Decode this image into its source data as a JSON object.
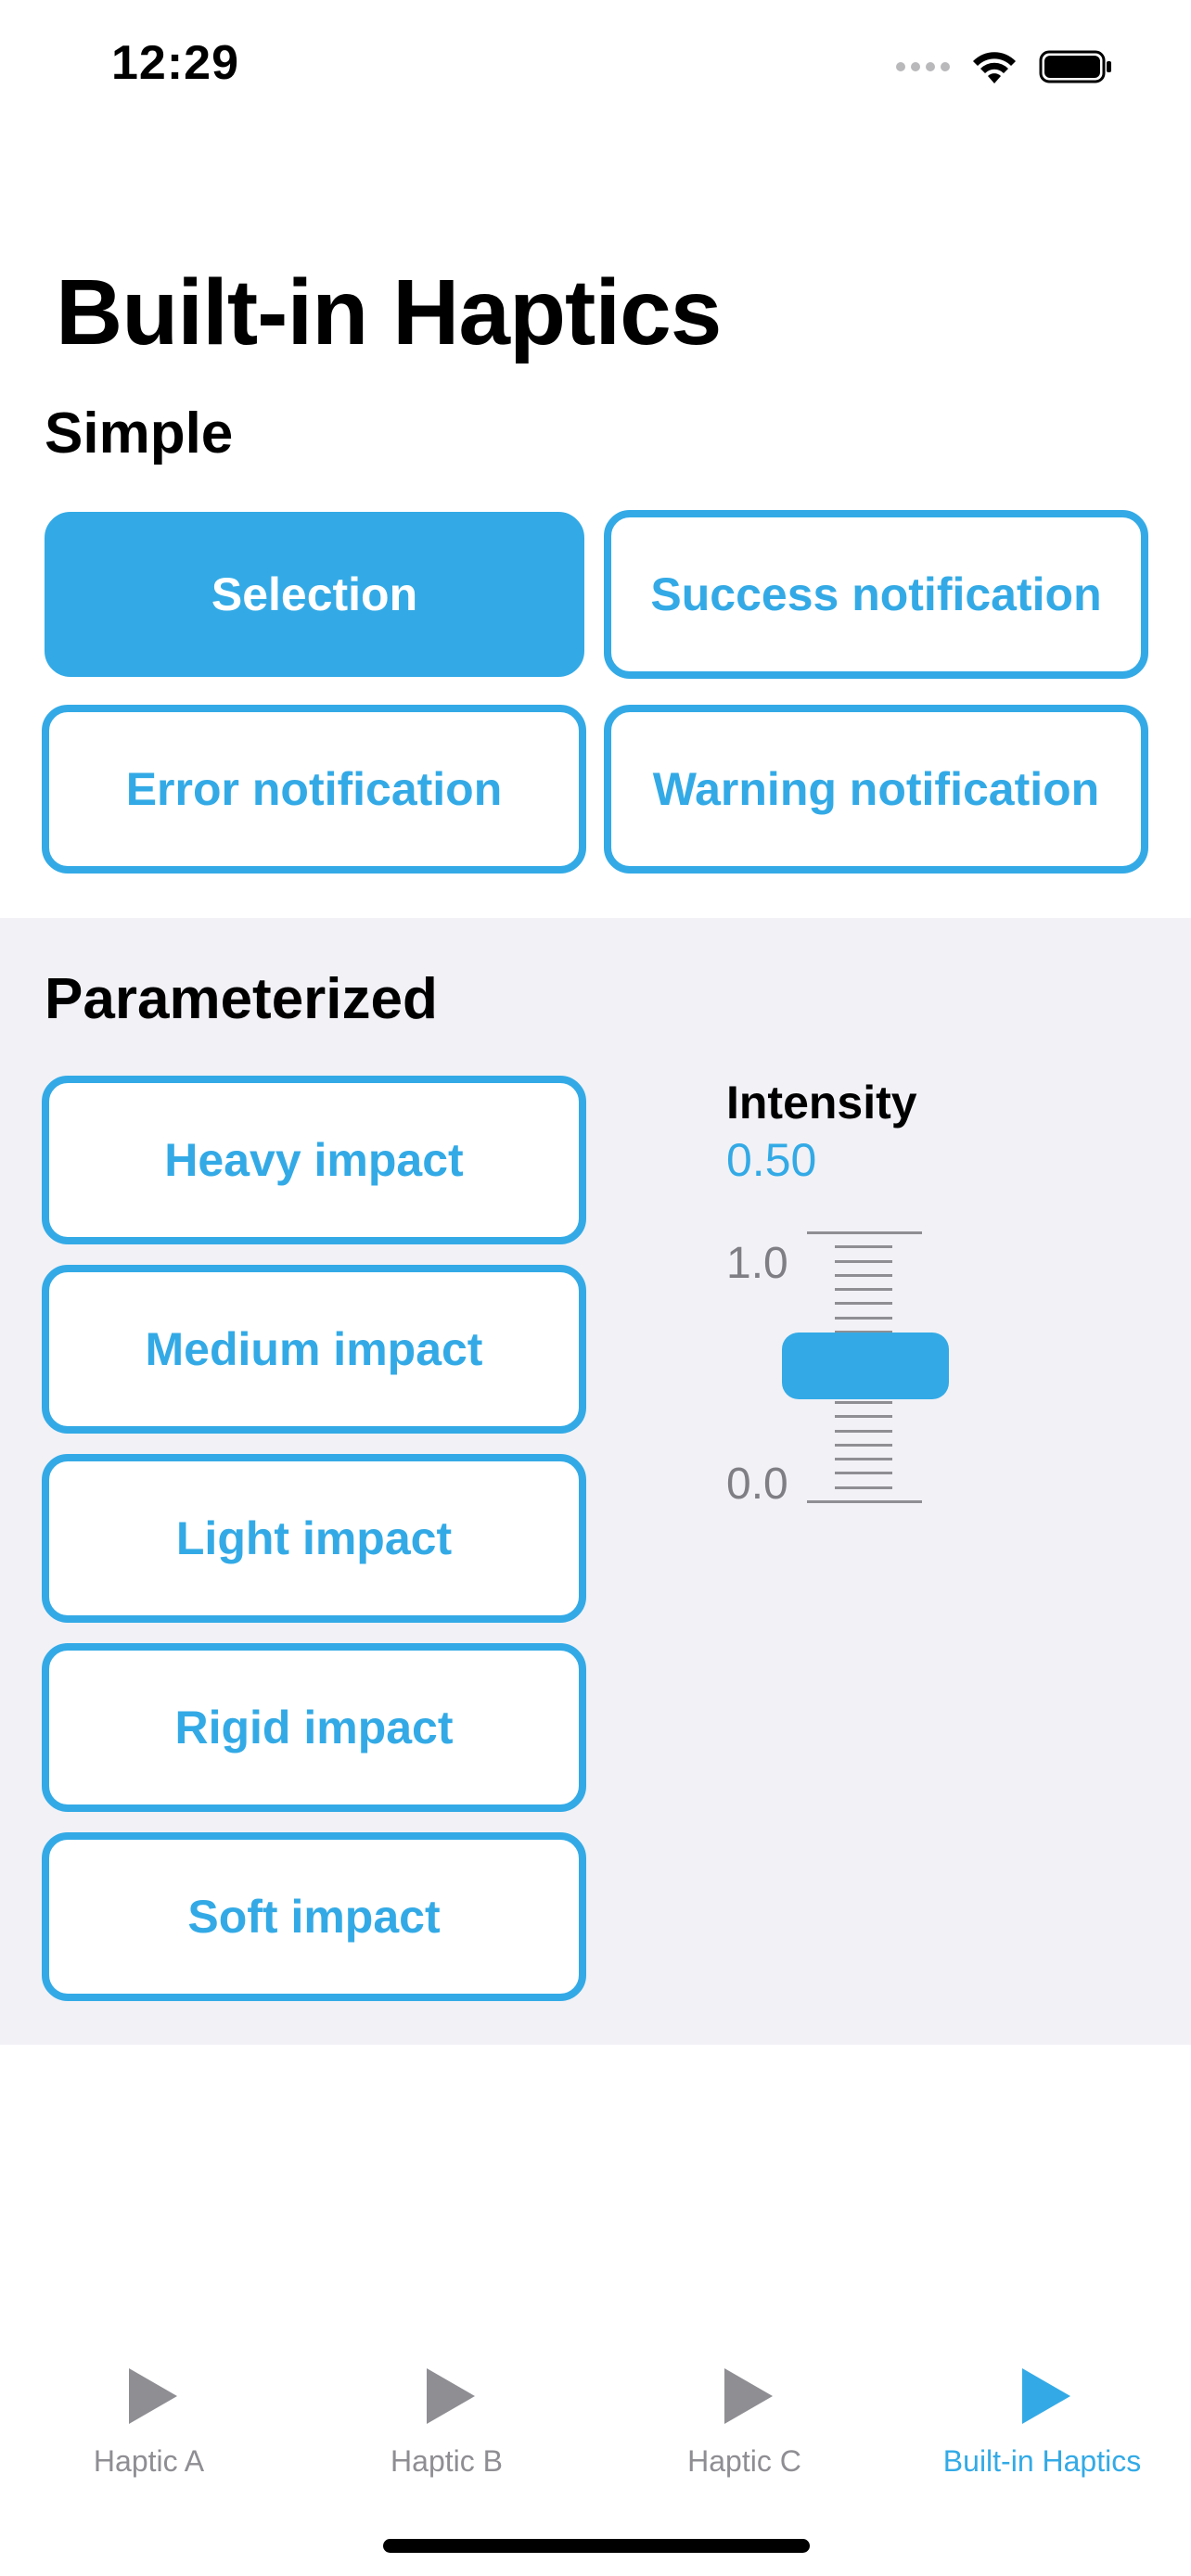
{
  "status_bar": {
    "time": "12:29"
  },
  "page_title": "Built-in Haptics",
  "simple": {
    "title": "Simple",
    "buttons": [
      {
        "label": "Selection",
        "selected": true
      },
      {
        "label": "Success notification"
      },
      {
        "label": "Error notification"
      },
      {
        "label": "Warning notification"
      }
    ]
  },
  "parameterized": {
    "title": "Parameterized",
    "buttons": [
      {
        "label": "Heavy impact"
      },
      {
        "label": "Medium impact"
      },
      {
        "label": "Light impact"
      },
      {
        "label": "Rigid impact"
      },
      {
        "label": "Soft impact"
      }
    ],
    "intensity": {
      "label": "Intensity",
      "value_text": "0.50",
      "value": 0.5,
      "max_label": "1.0",
      "min_label": "0.0"
    }
  },
  "tab_bar": {
    "tabs": [
      {
        "label": "Haptic A",
        "icon": "play-icon"
      },
      {
        "label": "Haptic B",
        "icon": "play-icon"
      },
      {
        "label": "Haptic C",
        "icon": "play-icon"
      },
      {
        "label": "Built-in Haptics",
        "icon": "play-icon",
        "active": true
      }
    ]
  },
  "colors": {
    "accent": "#33aae6",
    "section_background": "#f1f1f6",
    "inactive_tab": "#8e8e93"
  }
}
